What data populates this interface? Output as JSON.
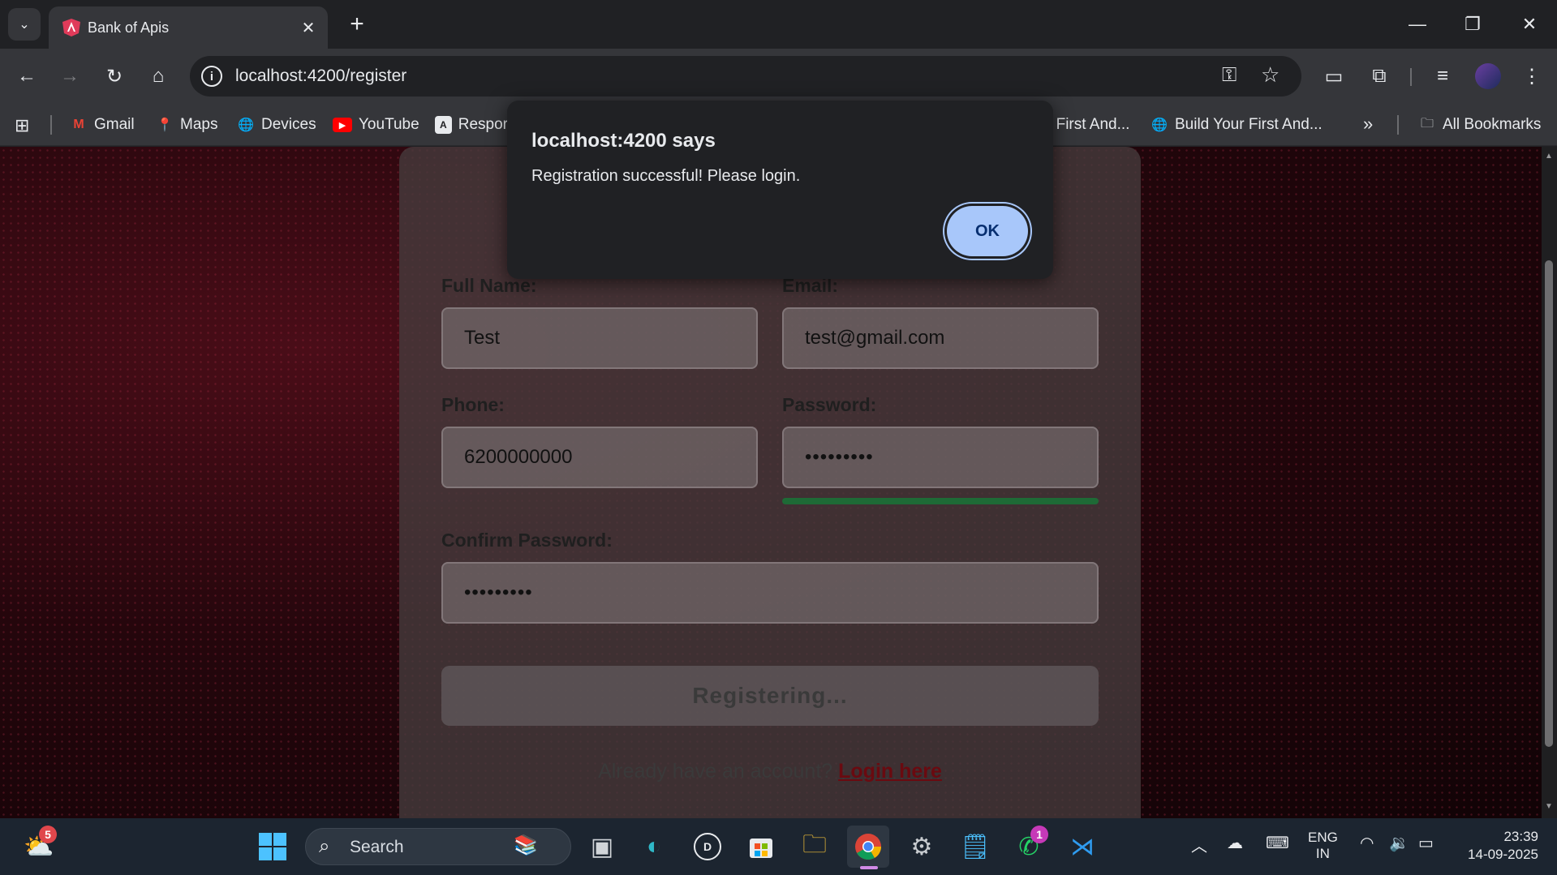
{
  "browser": {
    "tab_title": "Bank of Apis",
    "url": "localhost:4200/register",
    "bookmarks": [
      {
        "label": "Gmail",
        "icon": "gmail-icon"
      },
      {
        "label": "Maps",
        "icon": "maps-icon"
      },
      {
        "label": "Devices",
        "icon": "globe-icon"
      },
      {
        "label": "YouTube",
        "icon": "youtube-icon"
      },
      {
        "label": "Respor",
        "icon": "angular-icon"
      },
      {
        "label": "r First And...",
        "icon": ""
      },
      {
        "label": "Build Your First And...",
        "icon": "globe-icon"
      }
    ],
    "all_bookmarks": "All Bookmarks"
  },
  "dialog": {
    "title": "localhost:4200 says",
    "message": "Registration successful! Please login.",
    "ok_label": "OK"
  },
  "form": {
    "full_name_label": "Full Name:",
    "full_name_value": "Test",
    "email_label": "Email:",
    "email_value": "test@gmail.com",
    "phone_label": "Phone:",
    "phone_value": "6200000000",
    "password_label": "Password:",
    "password_value": "•••••••••",
    "confirm_label": "Confirm Password:",
    "confirm_value": "•••••••••",
    "submit_label": "Registering...",
    "login_prompt": "Already have an account? ",
    "login_link": "Login here"
  },
  "taskbar": {
    "weather_badge": "5",
    "search_label": "Search",
    "whatsapp_badge": "1",
    "lang_top": "ENG",
    "lang_bottom": "IN",
    "time": "23:39",
    "date": "14-09-2025"
  },
  "colors": {
    "dialog_ok": "#a8c7fa",
    "strength_bar": "#1e6a36",
    "login_link": "#6a0a10"
  }
}
